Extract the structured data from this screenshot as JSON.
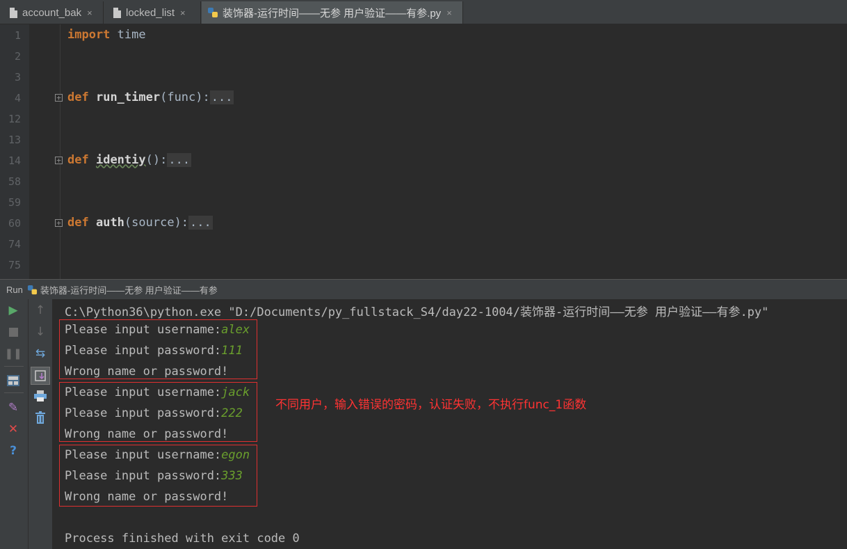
{
  "tabs": [
    {
      "label": "account_bak",
      "close": "×",
      "active": false
    },
    {
      "label": "locked_list",
      "close": "×",
      "active": false
    },
    {
      "label": "装饰器-运行时间——无参 用户验证——有参.py",
      "close": "×",
      "active": true
    }
  ],
  "editor": {
    "lines": [
      {
        "num": "1"
      },
      {
        "num": "2"
      },
      {
        "num": "3"
      },
      {
        "num": "4"
      },
      {
        "num": "12"
      },
      {
        "num": "13"
      },
      {
        "num": "14"
      },
      {
        "num": "58"
      },
      {
        "num": "59"
      },
      {
        "num": "60"
      },
      {
        "num": "74"
      },
      {
        "num": "75"
      }
    ],
    "code": {
      "import_kw": "import",
      "import_mod": " time",
      "def_kw": "def",
      "run_timer_name": "run_timer",
      "run_timer_args": "(func):",
      "identiy_name": "identiy",
      "identiy_args": "():",
      "auth_name": "auth",
      "auth_args": "(source):",
      "folded": "..."
    },
    "fold_mark": "+"
  },
  "run_bar": {
    "label": "Run",
    "config_name": "装饰器-运行时间——无参 用户验证——有参"
  },
  "console": {
    "command": "C:\\Python36\\python.exe \"D:/Documents/py_fullstack_S4/day22-1004/装饰器-运行时间——无参 用户验证——有参.py\"",
    "username_prompt": "Please input username:",
    "password_prompt": "Please input password:",
    "error_msg": "Wrong name or password!",
    "attempts": [
      {
        "username": "alex",
        "password": "111"
      },
      {
        "username": "jack",
        "password": "222"
      },
      {
        "username": "egon",
        "password": "333"
      }
    ],
    "exit_msg": "Process finished with exit code 0"
  },
  "annotation": "不同用户，输入错误的密码，认证失败，不执行func_1函数",
  "toolbar_icons": [
    "run-icon",
    "stop-icon",
    "pause-icon",
    "layout-icon",
    "pin-icon",
    "close-icon",
    "help-icon",
    "up-arrow-icon",
    "down-arrow-icon",
    "soft-wrap-icon",
    "scroll-to-end-icon",
    "print-icon",
    "trash-icon"
  ],
  "colors": {
    "keyword": "#cc7832",
    "user_input": "#6a9f2d",
    "annotation": "#ff3333",
    "box": "#e03030"
  }
}
